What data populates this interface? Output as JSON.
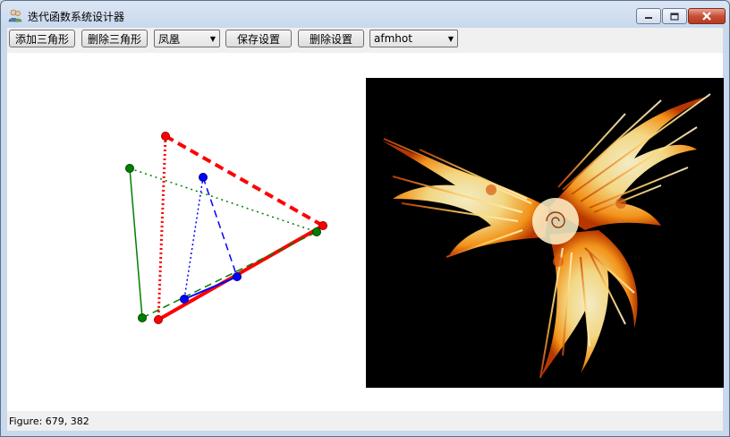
{
  "window": {
    "title": "迭代函数系统设计器"
  },
  "toolbar": {
    "add_triangle": "添加三角形",
    "delete_triangle": "删除三角形",
    "preset_selected": "凤凰",
    "save_settings": "保存设置",
    "delete_settings": "删除设置",
    "colormap_selected": "afmhot"
  },
  "status": {
    "text": "Figure: 679, 382"
  },
  "colors": {
    "red": "#ff0000",
    "green": "#008000",
    "blue": "#0000ff",
    "fractal_background": "#000000",
    "fractal_fill": "#ffd070"
  },
  "icons": {
    "app": "people-icon",
    "minimize": "minimize-icon",
    "maximize": "maximize-icon",
    "close": "close-icon",
    "dropdown": "chevron-down-icon"
  }
}
